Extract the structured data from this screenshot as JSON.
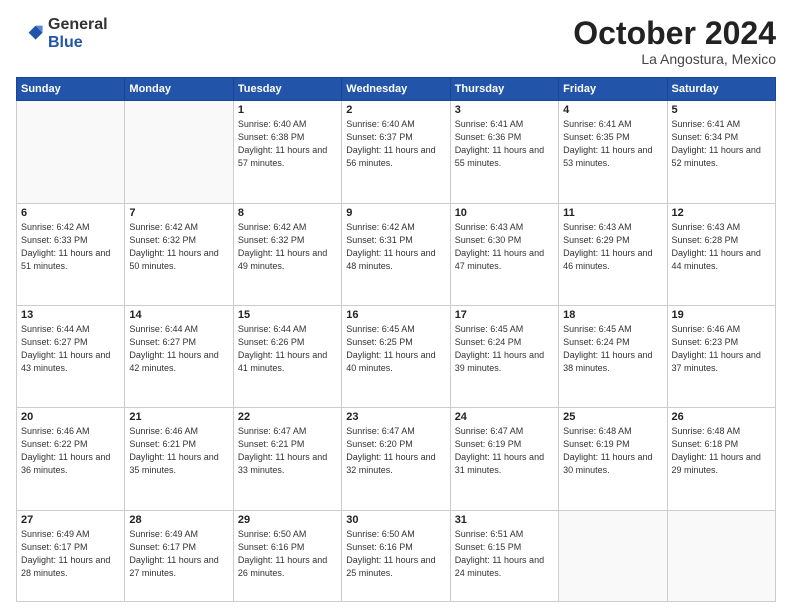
{
  "logo": {
    "general": "General",
    "blue": "Blue"
  },
  "header": {
    "month": "October 2024",
    "location": "La Angostura, Mexico"
  },
  "weekdays": [
    "Sunday",
    "Monday",
    "Tuesday",
    "Wednesday",
    "Thursday",
    "Friday",
    "Saturday"
  ],
  "weeks": [
    [
      {
        "day": "",
        "info": ""
      },
      {
        "day": "",
        "info": ""
      },
      {
        "day": "1",
        "info": "Sunrise: 6:40 AM\nSunset: 6:38 PM\nDaylight: 11 hours and 57 minutes."
      },
      {
        "day": "2",
        "info": "Sunrise: 6:40 AM\nSunset: 6:37 PM\nDaylight: 11 hours and 56 minutes."
      },
      {
        "day": "3",
        "info": "Sunrise: 6:41 AM\nSunset: 6:36 PM\nDaylight: 11 hours and 55 minutes."
      },
      {
        "day": "4",
        "info": "Sunrise: 6:41 AM\nSunset: 6:35 PM\nDaylight: 11 hours and 53 minutes."
      },
      {
        "day": "5",
        "info": "Sunrise: 6:41 AM\nSunset: 6:34 PM\nDaylight: 11 hours and 52 minutes."
      }
    ],
    [
      {
        "day": "6",
        "info": "Sunrise: 6:42 AM\nSunset: 6:33 PM\nDaylight: 11 hours and 51 minutes."
      },
      {
        "day": "7",
        "info": "Sunrise: 6:42 AM\nSunset: 6:32 PM\nDaylight: 11 hours and 50 minutes."
      },
      {
        "day": "8",
        "info": "Sunrise: 6:42 AM\nSunset: 6:32 PM\nDaylight: 11 hours and 49 minutes."
      },
      {
        "day": "9",
        "info": "Sunrise: 6:42 AM\nSunset: 6:31 PM\nDaylight: 11 hours and 48 minutes."
      },
      {
        "day": "10",
        "info": "Sunrise: 6:43 AM\nSunset: 6:30 PM\nDaylight: 11 hours and 47 minutes."
      },
      {
        "day": "11",
        "info": "Sunrise: 6:43 AM\nSunset: 6:29 PM\nDaylight: 11 hours and 46 minutes."
      },
      {
        "day": "12",
        "info": "Sunrise: 6:43 AM\nSunset: 6:28 PM\nDaylight: 11 hours and 44 minutes."
      }
    ],
    [
      {
        "day": "13",
        "info": "Sunrise: 6:44 AM\nSunset: 6:27 PM\nDaylight: 11 hours and 43 minutes."
      },
      {
        "day": "14",
        "info": "Sunrise: 6:44 AM\nSunset: 6:27 PM\nDaylight: 11 hours and 42 minutes."
      },
      {
        "day": "15",
        "info": "Sunrise: 6:44 AM\nSunset: 6:26 PM\nDaylight: 11 hours and 41 minutes."
      },
      {
        "day": "16",
        "info": "Sunrise: 6:45 AM\nSunset: 6:25 PM\nDaylight: 11 hours and 40 minutes."
      },
      {
        "day": "17",
        "info": "Sunrise: 6:45 AM\nSunset: 6:24 PM\nDaylight: 11 hours and 39 minutes."
      },
      {
        "day": "18",
        "info": "Sunrise: 6:45 AM\nSunset: 6:24 PM\nDaylight: 11 hours and 38 minutes."
      },
      {
        "day": "19",
        "info": "Sunrise: 6:46 AM\nSunset: 6:23 PM\nDaylight: 11 hours and 37 minutes."
      }
    ],
    [
      {
        "day": "20",
        "info": "Sunrise: 6:46 AM\nSunset: 6:22 PM\nDaylight: 11 hours and 36 minutes."
      },
      {
        "day": "21",
        "info": "Sunrise: 6:46 AM\nSunset: 6:21 PM\nDaylight: 11 hours and 35 minutes."
      },
      {
        "day": "22",
        "info": "Sunrise: 6:47 AM\nSunset: 6:21 PM\nDaylight: 11 hours and 33 minutes."
      },
      {
        "day": "23",
        "info": "Sunrise: 6:47 AM\nSunset: 6:20 PM\nDaylight: 11 hours and 32 minutes."
      },
      {
        "day": "24",
        "info": "Sunrise: 6:47 AM\nSunset: 6:19 PM\nDaylight: 11 hours and 31 minutes."
      },
      {
        "day": "25",
        "info": "Sunrise: 6:48 AM\nSunset: 6:19 PM\nDaylight: 11 hours and 30 minutes."
      },
      {
        "day": "26",
        "info": "Sunrise: 6:48 AM\nSunset: 6:18 PM\nDaylight: 11 hours and 29 minutes."
      }
    ],
    [
      {
        "day": "27",
        "info": "Sunrise: 6:49 AM\nSunset: 6:17 PM\nDaylight: 11 hours and 28 minutes."
      },
      {
        "day": "28",
        "info": "Sunrise: 6:49 AM\nSunset: 6:17 PM\nDaylight: 11 hours and 27 minutes."
      },
      {
        "day": "29",
        "info": "Sunrise: 6:50 AM\nSunset: 6:16 PM\nDaylight: 11 hours and 26 minutes."
      },
      {
        "day": "30",
        "info": "Sunrise: 6:50 AM\nSunset: 6:16 PM\nDaylight: 11 hours and 25 minutes."
      },
      {
        "day": "31",
        "info": "Sunrise: 6:51 AM\nSunset: 6:15 PM\nDaylight: 11 hours and 24 minutes."
      },
      {
        "day": "",
        "info": ""
      },
      {
        "day": "",
        "info": ""
      }
    ]
  ]
}
